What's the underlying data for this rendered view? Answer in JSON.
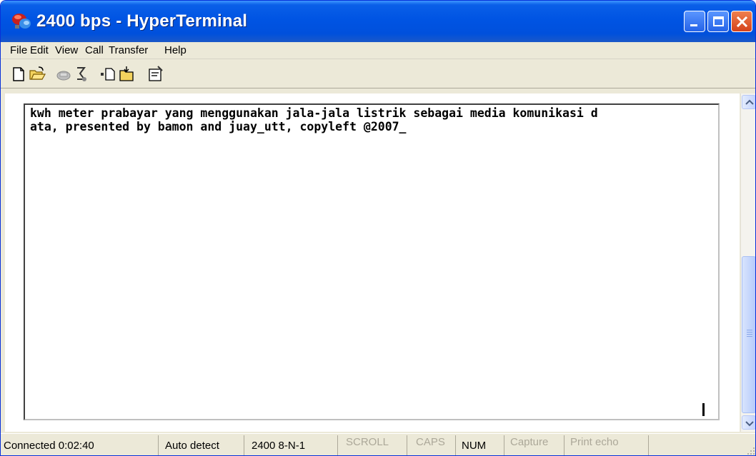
{
  "window": {
    "title": "2400 bps - HyperTerminal",
    "accent_color": "#0054e3",
    "controls": [
      "minimize-icon",
      "maximize-icon",
      "close-icon"
    ]
  },
  "menu": {
    "items": [
      "File",
      "Edit",
      "View",
      "Call",
      "Transfer",
      "Help"
    ]
  },
  "toolbar": {
    "icons": [
      "new-connection-icon",
      "open-icon",
      "connect-icon",
      "disconnect-icon",
      "send-icon",
      "receive-icon",
      "properties-icon"
    ]
  },
  "terminal": {
    "lines": [
      "kwh meter prabayar yang menggunakan jala-jala listrik sebagai media komunikasi d",
      "ata, presented by bamon and juay_utt, copyleft @2007_"
    ]
  },
  "status": {
    "connection": "Connected 0:02:40",
    "detect": "Auto detect",
    "port_settings": "2400 8-N-1",
    "scroll": "SCROLL",
    "caps": "CAPS",
    "num": "NUM",
    "capture": "Capture",
    "print_echo": "Print echo"
  }
}
